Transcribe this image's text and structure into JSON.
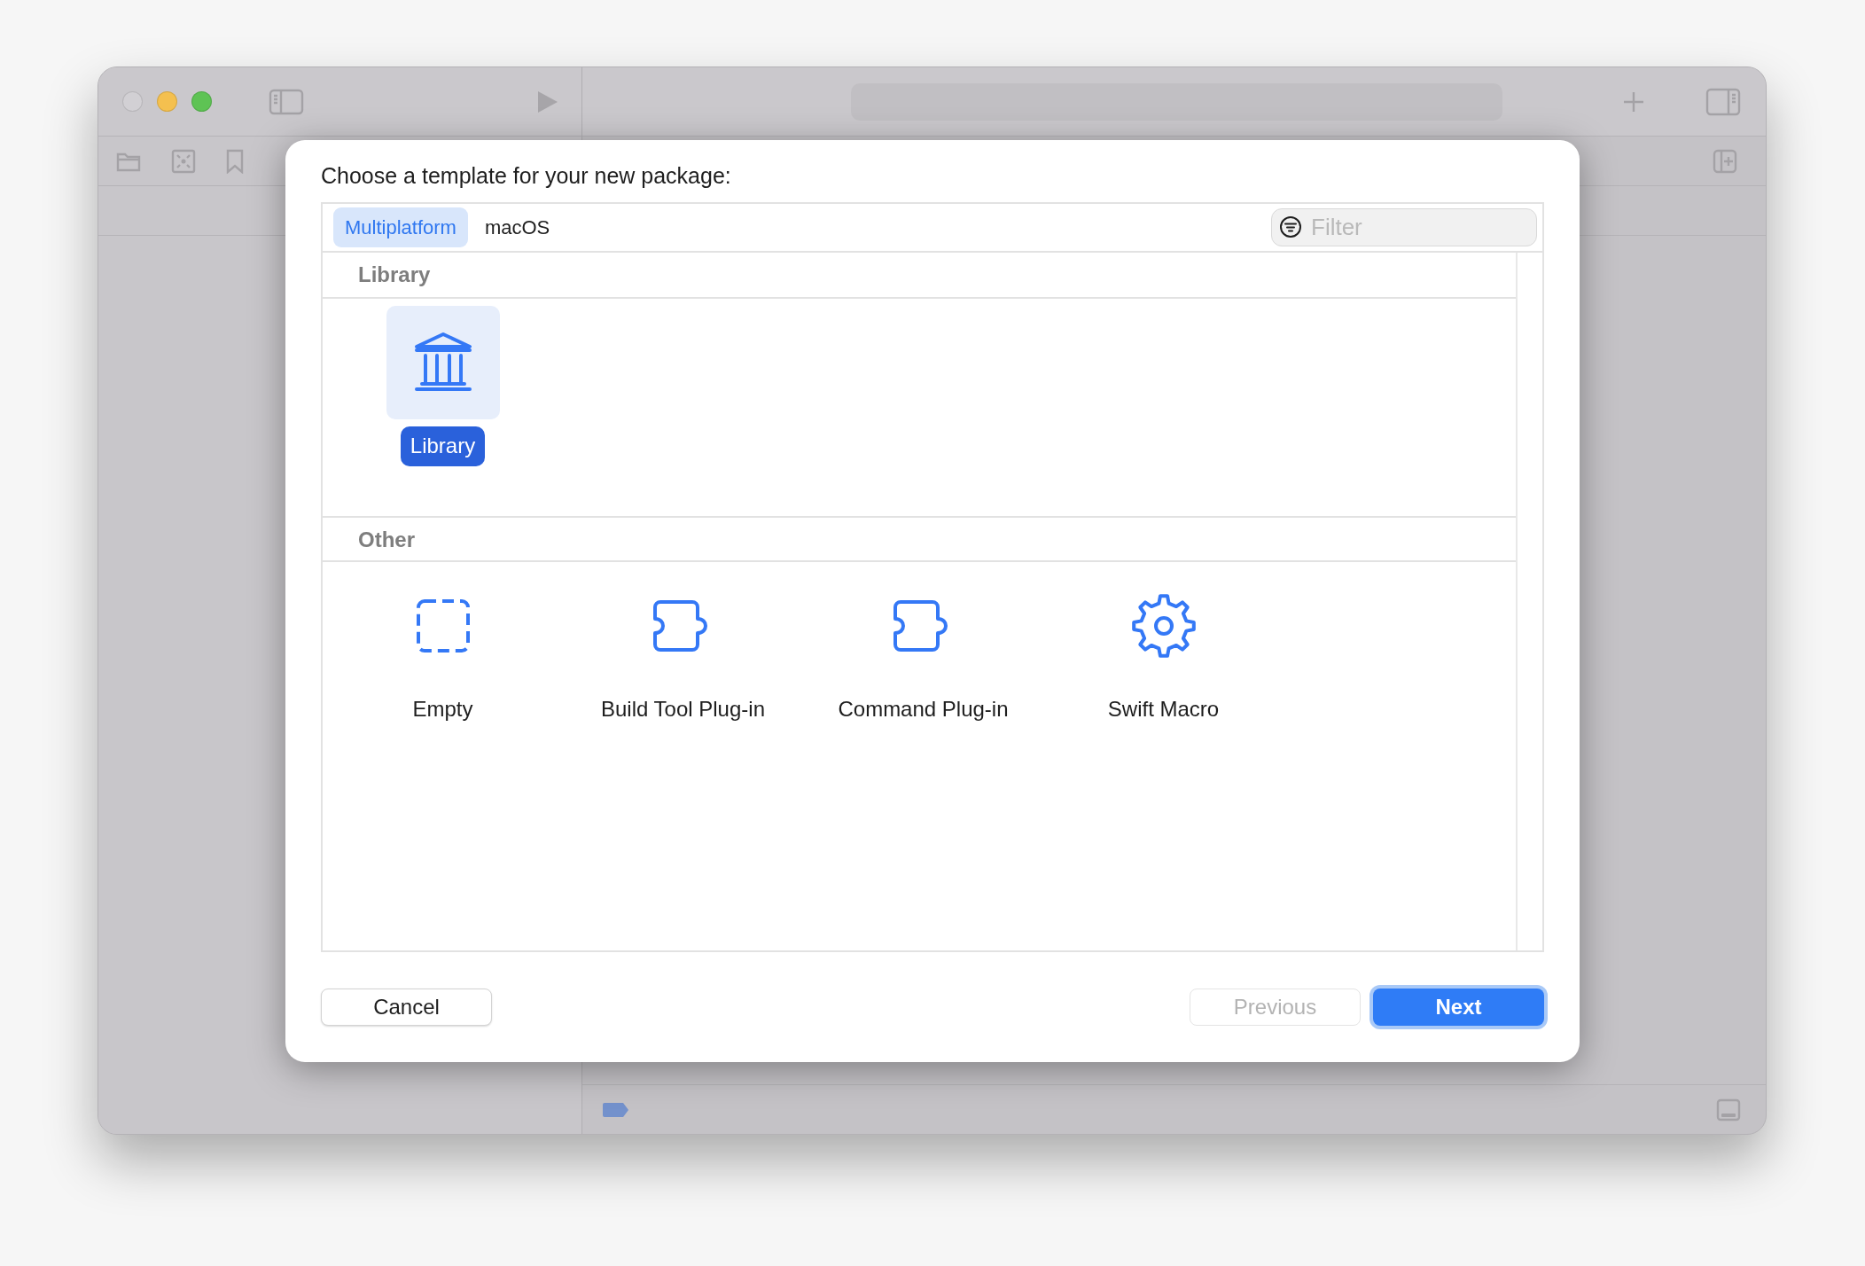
{
  "dialog": {
    "title": "Choose a template for your new package:",
    "tabs": [
      {
        "label": "Multiplatform",
        "selected": true
      },
      {
        "label": "macOS",
        "selected": false
      }
    ],
    "filter": {
      "placeholder": "Filter"
    },
    "sections": [
      {
        "title": "Library",
        "templates": [
          {
            "label": "Library",
            "kind": "library",
            "selected": true
          }
        ]
      },
      {
        "title": "Other",
        "templates": [
          {
            "label": "Empty",
            "kind": "empty",
            "selected": false
          },
          {
            "label": "Build Tool Plug-in",
            "kind": "plugin",
            "selected": false
          },
          {
            "label": "Command Plug-in",
            "kind": "plugin",
            "selected": false
          },
          {
            "label": "Swift Macro",
            "kind": "macro",
            "selected": false
          }
        ]
      }
    ],
    "buttons": [
      {
        "label": "Cancel",
        "kind": "secondary",
        "disabled": false
      },
      {
        "label": "Previous",
        "kind": "secondary",
        "disabled": true
      },
      {
        "label": "Next",
        "kind": "primary",
        "disabled": false
      }
    ]
  }
}
